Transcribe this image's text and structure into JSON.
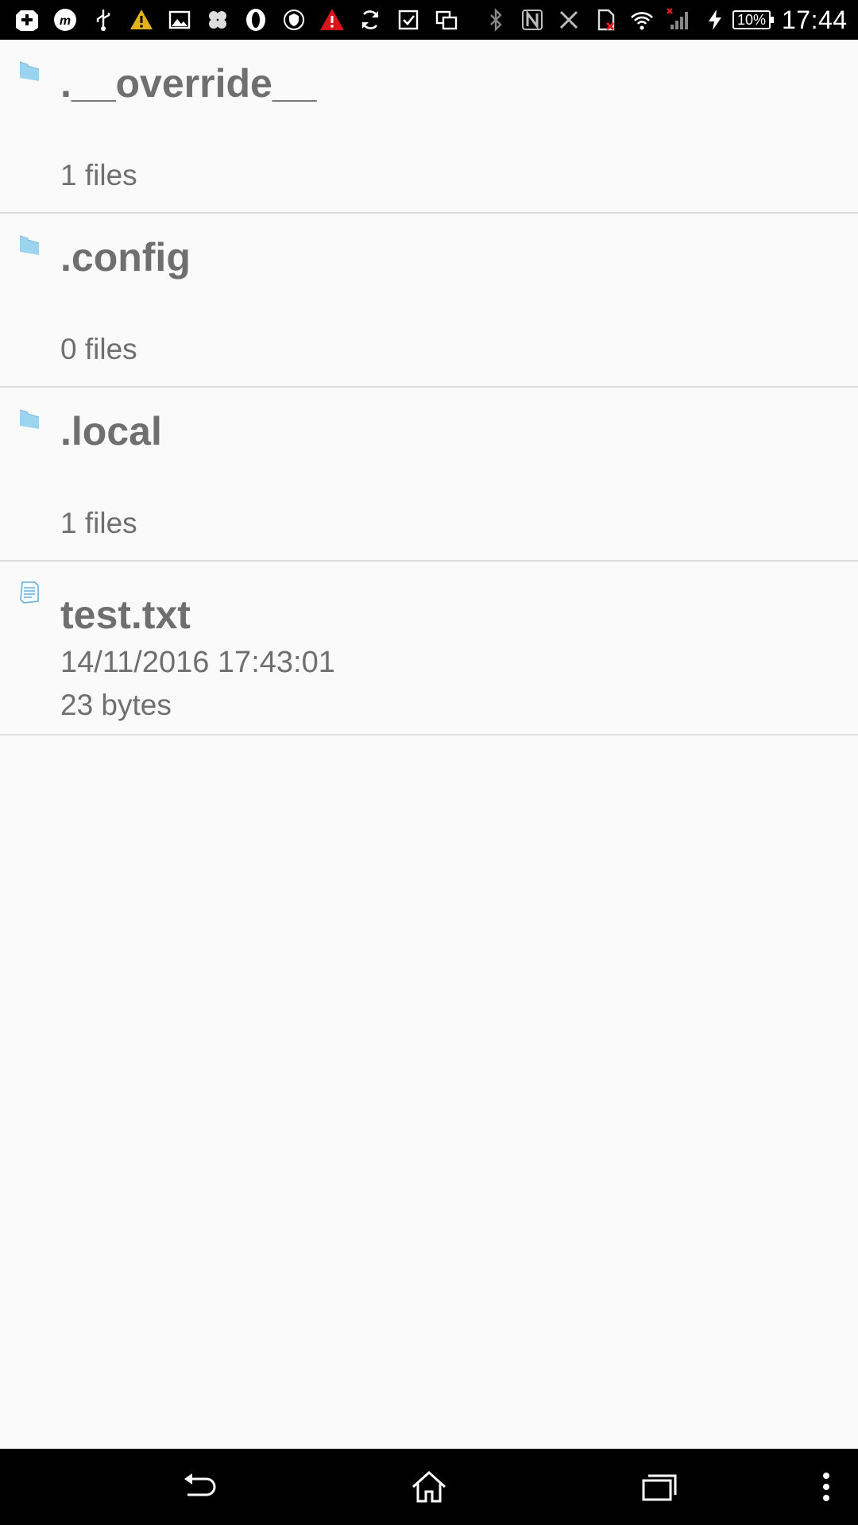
{
  "status_bar": {
    "time": "17:44",
    "battery_percent": "10%",
    "left_icons": [
      "add-notification-icon",
      "m-app-icon",
      "usb-icon",
      "warning-yellow-icon",
      "image-icon",
      "hexagon-app-icon",
      "opera-icon",
      "shield-app-icon",
      "warning-red-icon",
      "sync-icon",
      "checkbox-icon",
      "copy-icon"
    ],
    "right_icons": [
      "bluetooth-icon",
      "nfc-icon",
      "no-signal-x-icon",
      "sim-error-icon",
      "wifi-icon",
      "cell-signal-icon",
      "charging-icon"
    ]
  },
  "files": [
    {
      "name": ".__override__",
      "meta": "1 files",
      "type": "folder"
    },
    {
      "name": ".config",
      "meta": "0 files",
      "type": "folder"
    },
    {
      "name": ".local",
      "meta": "1 files",
      "type": "folder"
    },
    {
      "name": "test.txt",
      "date": "14/11/2016 17:43:01",
      "size": "23 bytes",
      "type": "file"
    }
  ],
  "colors": {
    "folder": "#9bd4ef",
    "text": "#6f6f6f",
    "divider": "#dddddd"
  },
  "nav_bar": {
    "icons": [
      "back-icon",
      "home-icon",
      "recents-icon",
      "overflow-menu-icon"
    ]
  }
}
